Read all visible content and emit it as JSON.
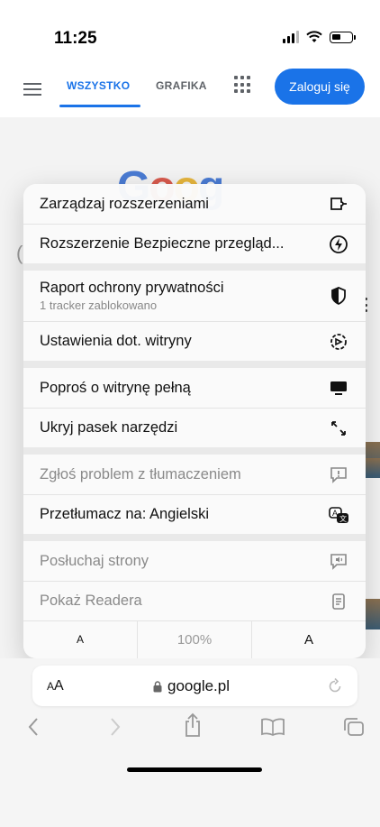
{
  "status_bar": {
    "time": "11:25"
  },
  "header": {
    "tab_all": "WSZYSTKO",
    "tab_images": "GRAFIKA",
    "login_label": "Zaloguj się"
  },
  "background": {
    "logo_peek": "Google"
  },
  "menu": {
    "items": [
      {
        "label": "Zarządzaj rozszerzeniami",
        "icon": "extension-icon"
      },
      {
        "label": "Rozszerzenie Bezpieczne przegląd...",
        "icon": "bolt-circle-icon"
      },
      {
        "label": "Raport ochrony prywatności",
        "sublabel": "1 tracker zablokowano",
        "icon": "shield-half-icon"
      },
      {
        "label": "Ustawienia dot. witryny",
        "icon": "site-settings-icon"
      },
      {
        "label": "Poproś o witrynę pełną",
        "icon": "desktop-icon"
      },
      {
        "label": "Ukryj pasek narzędzi",
        "icon": "collapse-arrows-icon"
      },
      {
        "label": "Zgłoś problem z tłumaczeniem",
        "icon": "report-bubble-icon",
        "disabled": true
      },
      {
        "label": "Przetłumacz na: Angielski",
        "icon": "translate-icon"
      },
      {
        "label": "Posłuchaj strony",
        "icon": "speaker-bubble-icon",
        "disabled": true
      },
      {
        "label": "Pokaż Readera",
        "icon": "reader-icon",
        "disabled": true
      }
    ],
    "zoom": {
      "decrease_label": "A",
      "value": "100%",
      "increase_label": "A"
    }
  },
  "address_bar": {
    "aa_small": "A",
    "aa_large": "A",
    "url": "google.pl"
  }
}
